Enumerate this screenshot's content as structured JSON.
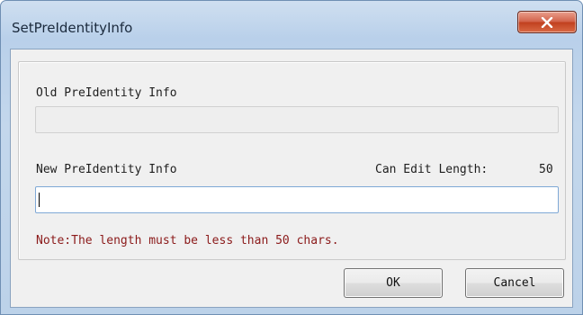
{
  "window": {
    "title": "SetPreIdentityInfo",
    "close_icon": "close-icon"
  },
  "form": {
    "old_label": "Old PreIdentity Info",
    "old_value": "",
    "new_label": "New PreIdentity Info",
    "new_value": "",
    "edit_length_label": "Can Edit Length:",
    "edit_length_value": "50",
    "note": "Note:The length must be less than 50 chars."
  },
  "buttons": {
    "ok": "OK",
    "cancel": "Cancel"
  },
  "colors": {
    "note_text": "#8b1a1a",
    "close_button": "#c1401f",
    "title_bar": "#bcd2e9"
  }
}
